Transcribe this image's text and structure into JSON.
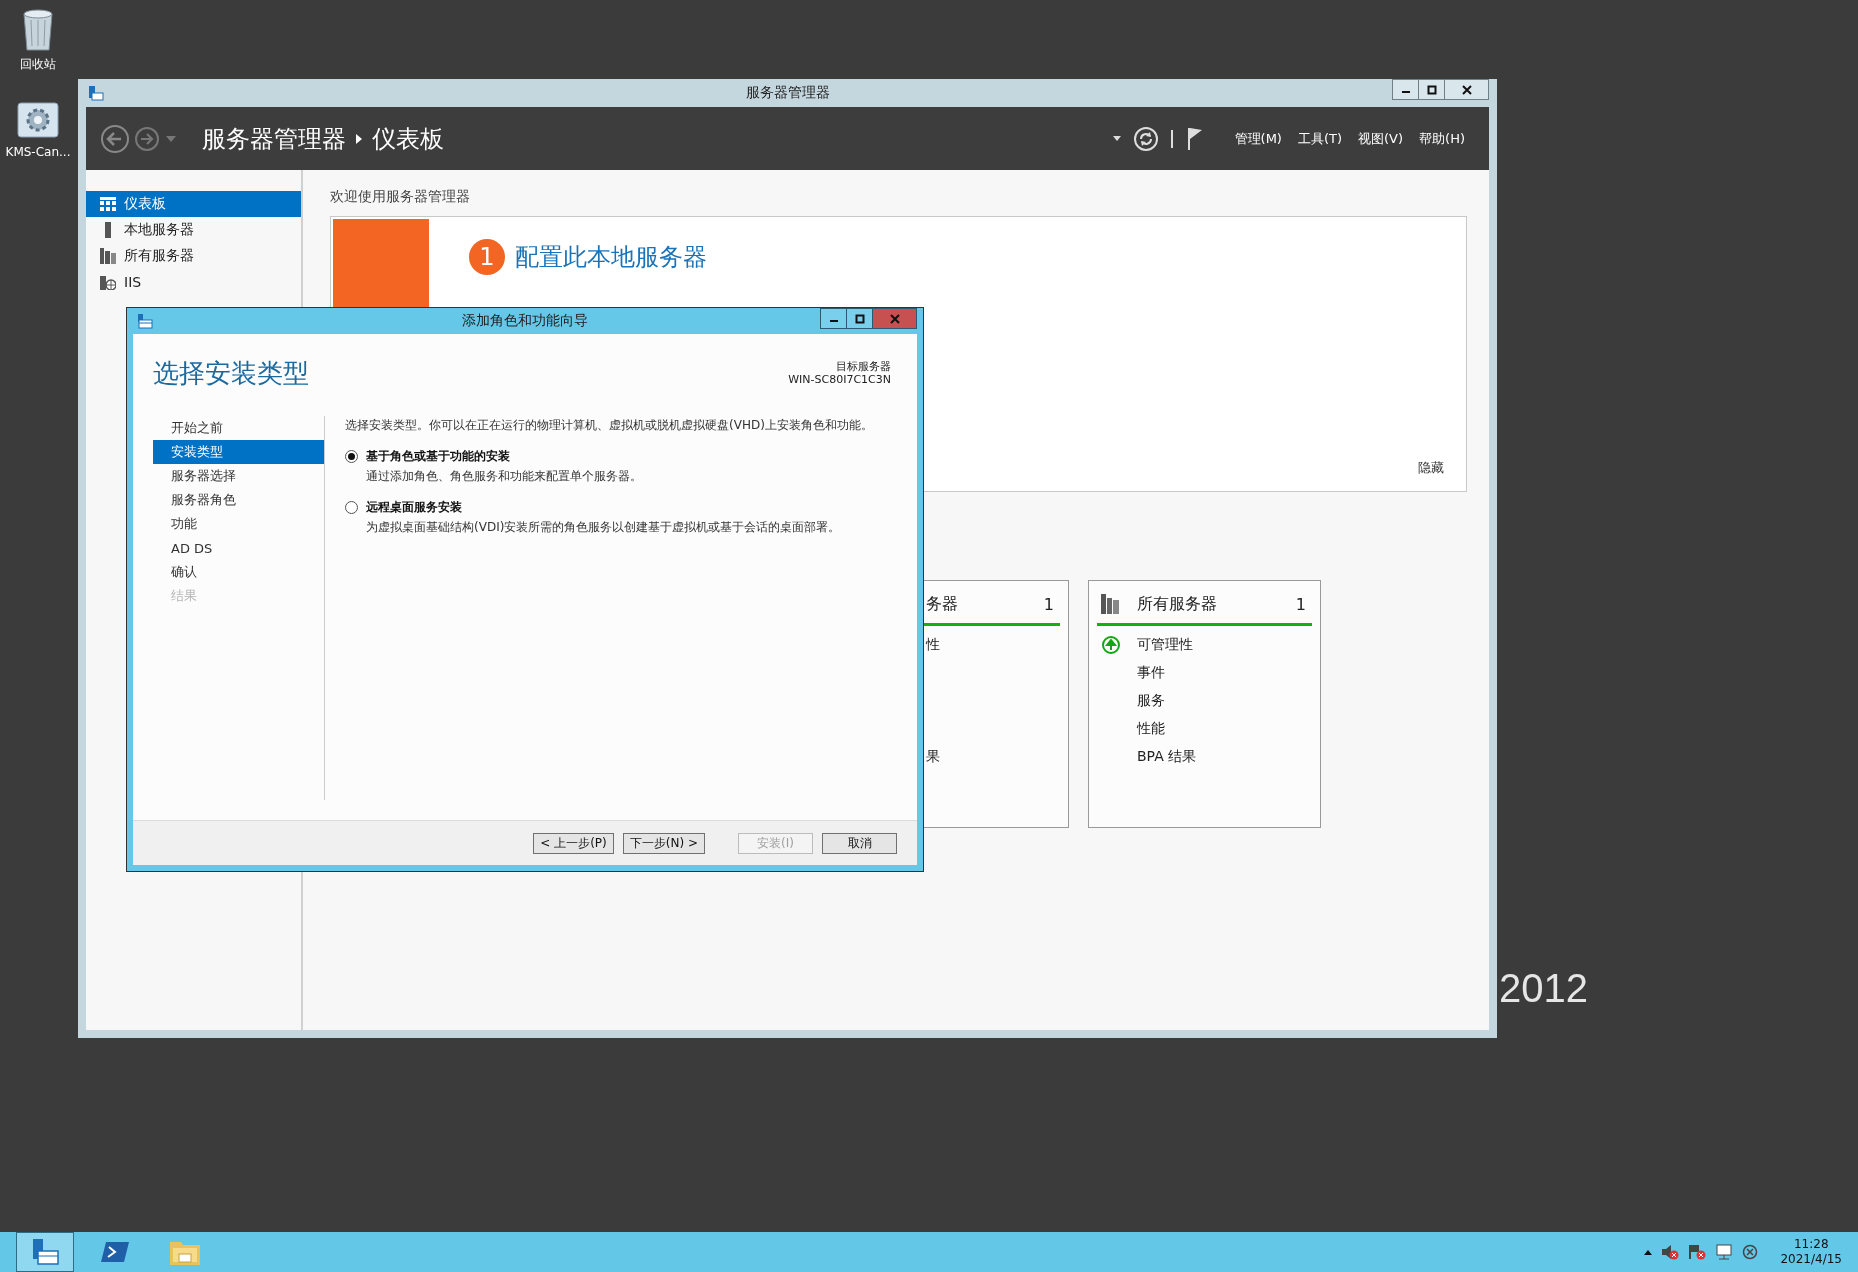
{
  "desktop_icons": [
    {
      "kind": "recycle-bin",
      "label": "回收站"
    },
    {
      "kind": "gear-app",
      "label": "KMS-Can..."
    }
  ],
  "desktop_text": "2012",
  "server_manager": {
    "title": "服务器管理器",
    "breadcrumb": [
      "服务器管理器",
      "仪表板"
    ],
    "menus": [
      "管理(M)",
      "工具(T)",
      "视图(V)",
      "帮助(H)"
    ],
    "sidebar": [
      {
        "kind": "dashboard",
        "label": "仪表板",
        "selected": true
      },
      {
        "kind": "server",
        "label": "本地服务器",
        "selected": false
      },
      {
        "kind": "servers",
        "label": "所有服务器",
        "selected": false
      },
      {
        "kind": "iis",
        "label": "IIS",
        "selected": false
      }
    ],
    "welcome": "欢迎使用服务器管理器",
    "quick_start": {
      "number": "1",
      "title": "配置此本地服务器",
      "hide": "隐藏"
    },
    "tiles": [
      {
        "title": "务器",
        "count": "1",
        "items": [
          {
            "text": "性",
            "status": false
          },
          {
            "text": "果",
            "status": false
          }
        ]
      },
      {
        "title": "所有服务器",
        "count": "1",
        "items": [
          {
            "text": "可管理性",
            "status": true
          },
          {
            "text": "事件",
            "status": false
          },
          {
            "text": "服务",
            "status": false
          },
          {
            "text": "性能",
            "status": false
          },
          {
            "text": "BPA 结果",
            "status": false
          }
        ]
      }
    ]
  },
  "wizard": {
    "title": "添加角色和功能向导",
    "heading": "选择安装类型",
    "target_label": "目标服务器",
    "target_server": "WIN-SC80I7C1C3N",
    "steps": [
      {
        "label": "开始之前",
        "selected": false,
        "disabled": false
      },
      {
        "label": "安装类型",
        "selected": true,
        "disabled": false
      },
      {
        "label": "服务器选择",
        "selected": false,
        "disabled": false
      },
      {
        "label": "服务器角色",
        "selected": false,
        "disabled": false
      },
      {
        "label": "功能",
        "selected": false,
        "disabled": false
      },
      {
        "label": "AD DS",
        "selected": false,
        "disabled": false
      },
      {
        "label": "确认",
        "selected": false,
        "disabled": false
      },
      {
        "label": "结果",
        "selected": false,
        "disabled": true
      }
    ],
    "description": "选择安装类型。你可以在正在运行的物理计算机、虚拟机或脱机虚拟硬盘(VHD)上安装角色和功能。",
    "options": [
      {
        "title": "基于角色或基于功能的安装",
        "description": "通过添加角色、角色服务和功能来配置单个服务器。",
        "selected": true
      },
      {
        "title": "远程桌面服务安装",
        "description": "为虚拟桌面基础结构(VDI)安装所需的角色服务以创建基于虚拟机或基于会话的桌面部署。",
        "selected": false
      }
    ],
    "buttons": [
      {
        "label": "< 上一步(P)",
        "disabled": false
      },
      {
        "label": "下一步(N) >",
        "disabled": false
      },
      {
        "label": "安装(I)",
        "disabled": true
      },
      {
        "label": "取消",
        "disabled": false
      }
    ]
  },
  "taskbar": {
    "apps": [
      {
        "kind": "server-manager",
        "selected": true
      },
      {
        "kind": "powershell",
        "selected": false
      },
      {
        "kind": "explorer",
        "selected": false
      }
    ],
    "time": "11:28",
    "date": "2021/4/15"
  }
}
